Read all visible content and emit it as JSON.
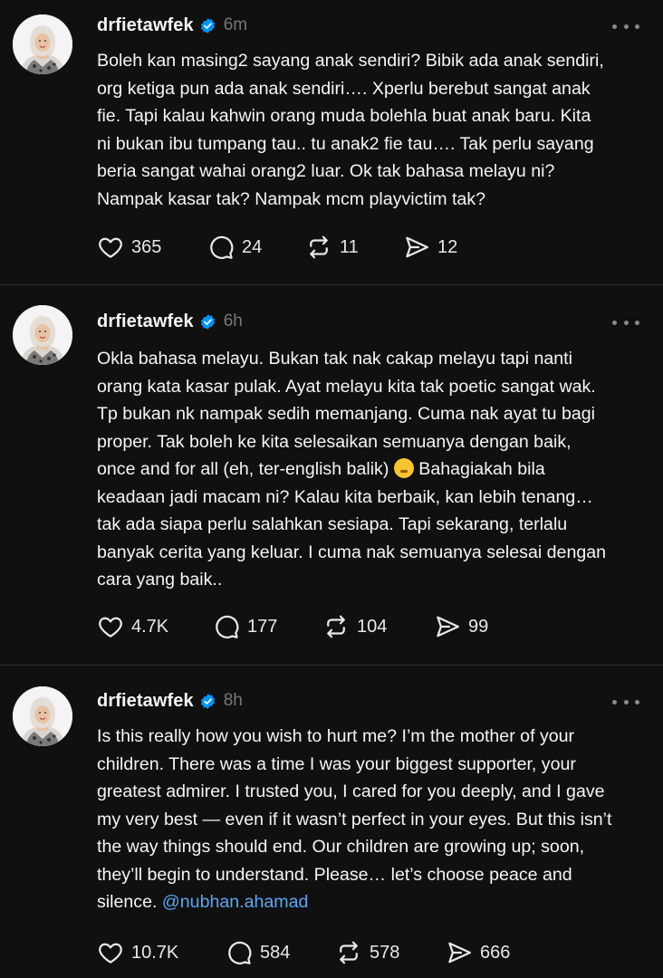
{
  "posts": [
    {
      "username": "drfietawfek",
      "time": "6m",
      "lines": [
        "Boleh kan masing2 sayang anak sendiri? Bibik ada anak sendiri,",
        "org ketiga pun ada anak sendiri…. Xperlu berebut sangat anak",
        "fie. Tapi kalau kahwin orang muda bolehla buat anak baru. Kita",
        "ni bukan ibu tumpang tau.. tu anak2 fie tau…. Tak perlu sayang",
        "beria sangat wahai orang2 luar. Ok tak bahasa melayu ni?",
        "Nampak kasar tak? Nampak mcm playvictim tak?"
      ],
      "likes": "365",
      "replies": "24",
      "reposts": "11",
      "shares": "12"
    },
    {
      "username": "drfietawfek",
      "time": "6h",
      "lines": [
        "Okla bahasa melayu. Bukan tak nak cakap melayu tapi nanti",
        "orang kata kasar pulak. Ayat melayu kita tak poetic sangat wak.",
        "Tp bukan nk nampak sedih memanjang. Cuma nak ayat tu bagi",
        "proper. Tak boleh ke kita selesaikan semuanya dengan baik,",
        "once and for all (eh, ter-english balik)",
        "keadaan jadi macam ni? Kalau kita berbaik, kan lebih tenang…",
        "tak ada siapa perlu salahkan sesiapa. Tapi sekarang, terlalu",
        "banyak cerita yang keluar. I cuma nak semuanya selesai dengan",
        "cara yang baik.."
      ],
      "line5_tail": " Bahagiakah bila",
      "likes": "4.7K",
      "replies": "177",
      "reposts": "104",
      "shares": "99"
    },
    {
      "username": "drfietawfek",
      "time": "8h",
      "lines": [
        "Is this really how you wish to hurt me? I’m the mother of your",
        "children. There was a time I was your biggest supporter, your",
        "greatest admirer. I trusted you, I cared for you deeply, and I gave",
        "my very best — even if it wasn’t perfect in your eyes. But this isn’t",
        "the way things should end. Our children are growing up; soon,",
        "they’ll begin to understand. Please… let’s choose peace and",
        "silence."
      ],
      "mention": "@nubhan.ahamad",
      "likes": "10.7K",
      "replies": "584",
      "reposts": "578",
      "shares": "666"
    }
  ],
  "icons": {
    "like": "heart-icon",
    "reply": "speech-bubble-icon",
    "repost": "repost-arrows-icon",
    "share": "send-icon",
    "verified": "verified-badge-icon",
    "more": "more-options-icon"
  },
  "colors": {
    "background": "#101010",
    "text": "#f3f5f7",
    "muted": "#777777",
    "link": "#5aa6f2",
    "verified": "#0095f6"
  }
}
